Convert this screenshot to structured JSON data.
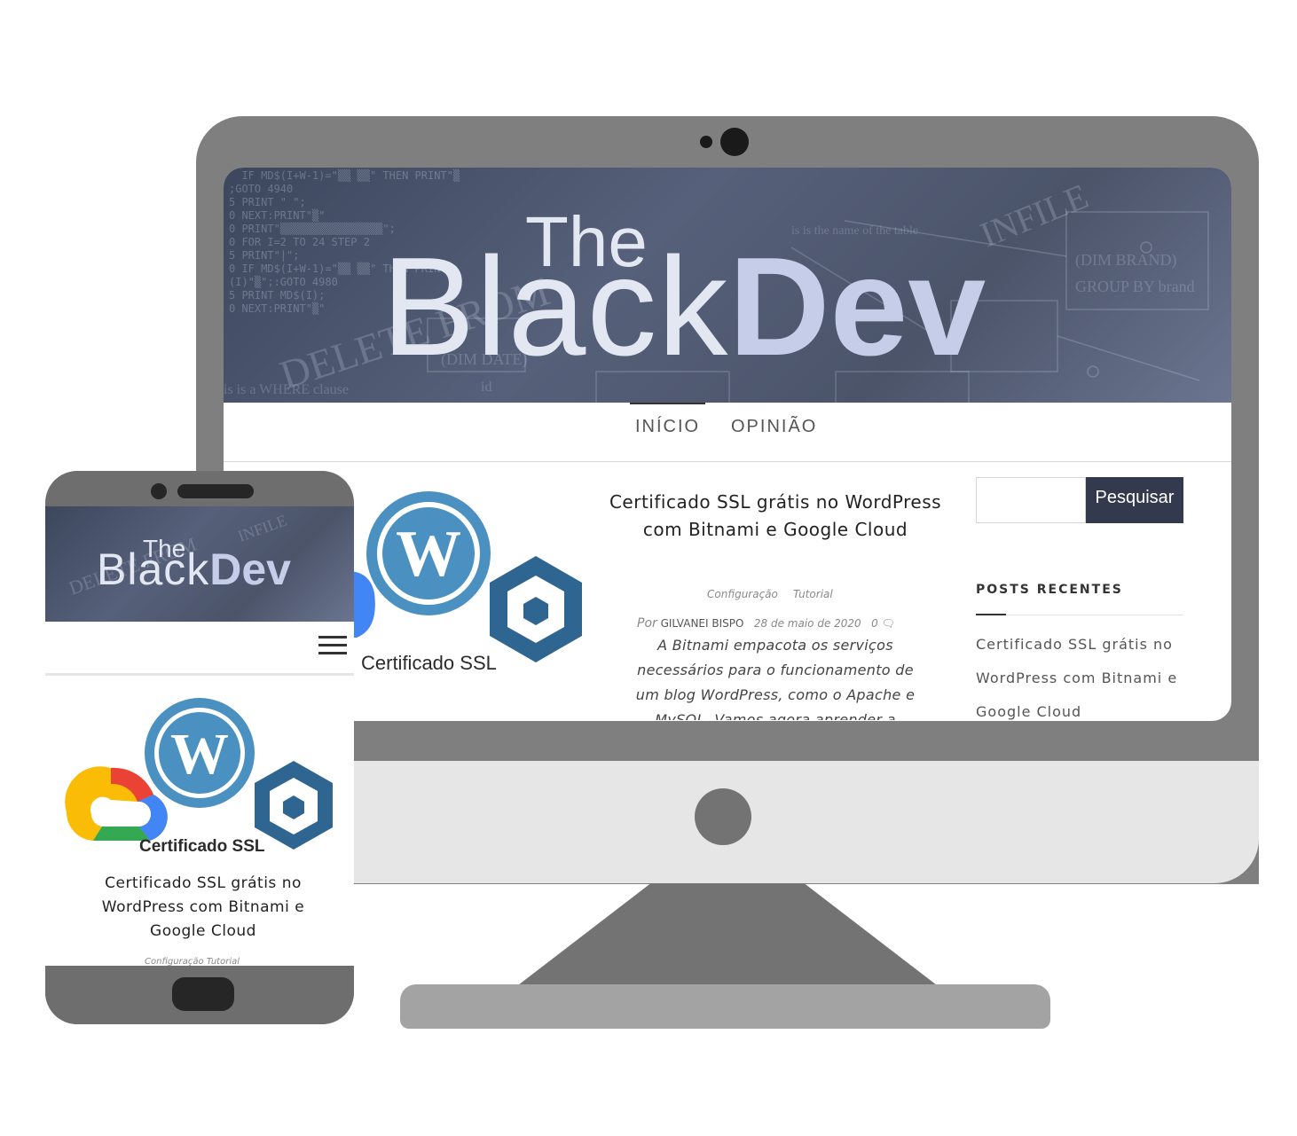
{
  "brand": {
    "logo_the": "The",
    "logo_black": "Black",
    "logo_dev": "Dev"
  },
  "nav": {
    "items": [
      {
        "label": "INÍCIO",
        "active": true
      },
      {
        "label": "OPINIÃO",
        "active": false
      }
    ]
  },
  "article": {
    "image_caption": "Certificado SSL",
    "title": "Certificado SSL grátis no WordPress com Bitnami e Google Cloud",
    "categories": [
      "Configuração",
      "Tutorial"
    ],
    "author_prefix": "Por",
    "author": "GILVANEI BISPO",
    "date": "28 de maio de 2020",
    "comments": "0",
    "excerpt": "A Bitnami empacota os serviços necessários para o funcionamento de um blog WordPress, como o Apache e MySQL. Vamos agora aprender a"
  },
  "sidebar": {
    "search_button": "Pesquisar",
    "search_value": "",
    "recent_title": "POSTS RECENTES",
    "recent_posts": [
      "Certificado SSL grátis no WordPress com Bitnami e Google Cloud"
    ]
  },
  "mobile": {
    "image_caption": "Certificado SSL",
    "title": "Certificado SSL grátis no WordPress com Bitnami e Google Cloud",
    "categories_line": "Configuração   Tutorial"
  },
  "colors": {
    "banner": "#4b5469",
    "search_button": "#343a4e",
    "wordpress_blue": "#4a90c0",
    "bitnami_blue": "#2f6691",
    "device_gray": "#7f7f7f"
  }
}
